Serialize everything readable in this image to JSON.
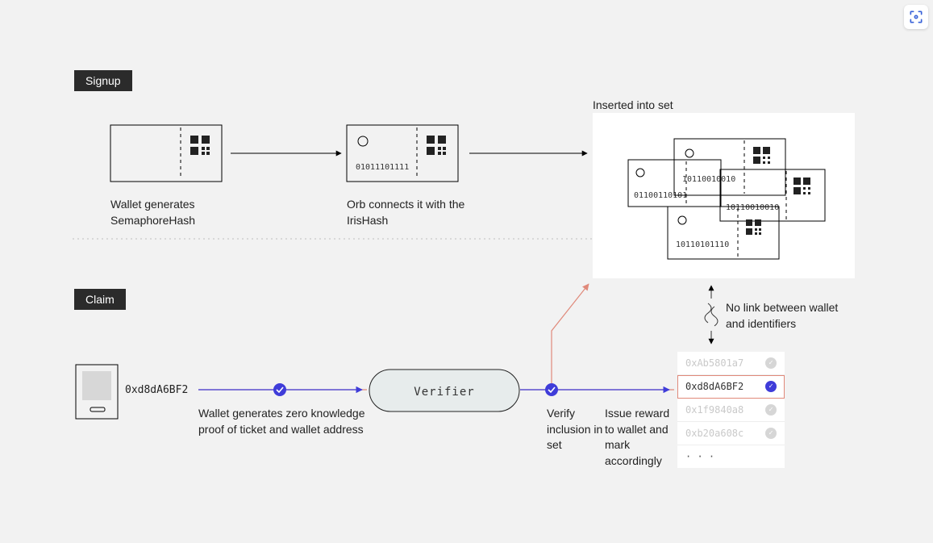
{
  "labels": {
    "signup": "Signup",
    "claim": "Claim",
    "inserted": "Inserted into set",
    "wallet_gen_sem": "Wallet generates SemaphoreHash",
    "orb_connect": "Orb connects it with the IrisHash",
    "no_link": "No link between wallet and identifiers",
    "wallet_addr": "0xd8dA6BF2",
    "zk_proof": "Wallet generates zero knowledge proof of ticket and wallet address",
    "verifier": "Verifier",
    "verify_incl": "Verify inclusion in set",
    "issue_reward": "Issue reward to wallet and mark accordingly",
    "ellipsis": "· · ·"
  },
  "codes": {
    "c1": "01011101111",
    "c2": "01100110101",
    "c3": "10110010010",
    "c4": "10110010010",
    "c5": "10110101110"
  },
  "address_list": [
    {
      "addr": "0xAb5801a7",
      "active": false
    },
    {
      "addr": "0xd8dA6BF2",
      "active": true
    },
    {
      "addr": "0x1f9840a8",
      "active": false
    },
    {
      "addr": "0xb20a608c",
      "active": false
    }
  ]
}
